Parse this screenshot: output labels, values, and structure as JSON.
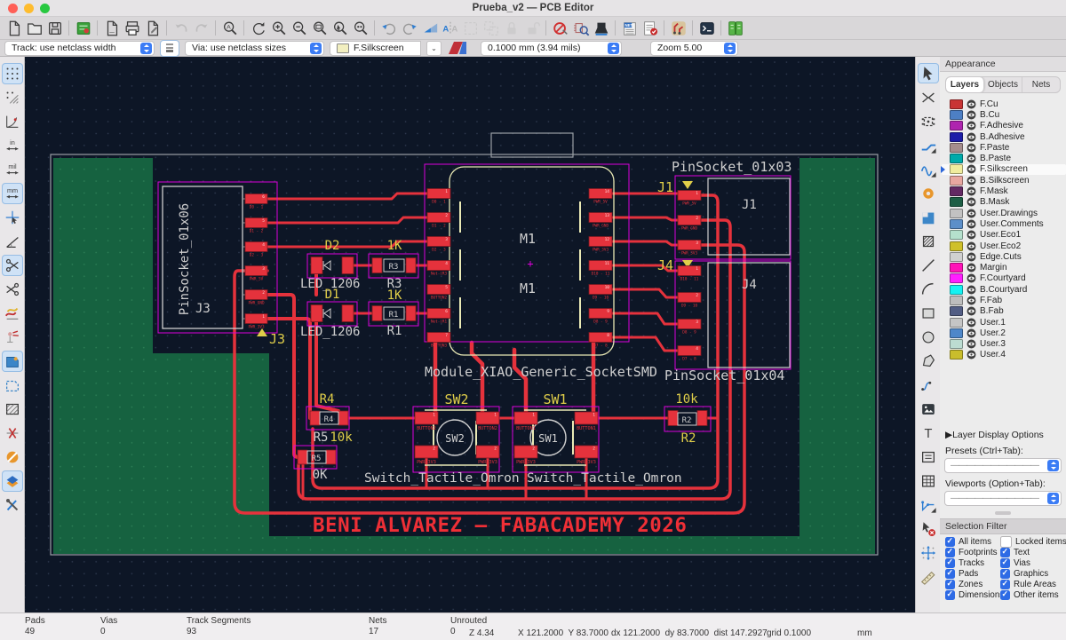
{
  "window": {
    "title": "Prueba_v2 — PCB Editor"
  },
  "toolbar_main": {
    "icons": [
      "new-board",
      "open-board",
      "save",
      "|",
      "board-setup",
      "|",
      "page-settings",
      "print",
      "plot",
      "|",
      "undo",
      "redo",
      "|",
      "find",
      "|",
      "refresh",
      "zoom-in",
      "zoom-out",
      "zoom-fit",
      "zoom-selection",
      "zoom-objects",
      "|",
      "rotate-ccw",
      "rotate-cw",
      "flip-board",
      "mirror",
      "group",
      "ungroup",
      "lock",
      "unlock",
      "|",
      "drc-exclusions",
      "footprint-checker",
      "plot-fab",
      "|",
      "net-inspector",
      "drc",
      "|",
      "router-settings",
      "|",
      "scripting-console",
      "|",
      "update-pcb"
    ],
    "disabled": [
      "undo",
      "redo",
      "group",
      "ungroup",
      "lock",
      "unlock"
    ]
  },
  "toolbar_options": {
    "track_combo": "Track: use netclass width",
    "via_combo": "Via: use netclass sizes",
    "layer_combo": "F.Silkscreen",
    "layer_swatch_color": "#f2efc0",
    "grid_combo": "0.1000 mm (3.94 mils)",
    "zoom_combo": "Zoom 5.00"
  },
  "left_toolbar": {
    "icons": [
      {
        "name": "grid-dots",
        "selected": true
      },
      {
        "name": "grid-override"
      },
      {
        "name": "polar-coords"
      },
      {
        "name": "units-inches",
        "label": "in"
      },
      {
        "name": "units-mils",
        "label": "mil"
      },
      {
        "name": "units-mm",
        "label": "mm",
        "selected": true
      },
      {
        "name": "cursor-shape"
      },
      {
        "name": "free-angle"
      },
      {
        "name": "trim-tracks",
        "selected": true
      },
      {
        "name": "delete-tracks"
      },
      {
        "name": "highlight-collisions"
      },
      {
        "name": "highlight-net"
      },
      {
        "name": "zone-fill-display",
        "selected": true
      },
      {
        "name": "zone-outline-display"
      },
      {
        "name": "zone-hatch-display"
      },
      {
        "name": "ratsnest-hide"
      },
      {
        "name": "ratsnest-curved"
      },
      {
        "name": "inspect-clearance",
        "selected": true
      },
      {
        "name": "preferences-tools"
      }
    ]
  },
  "right_toolbar": {
    "icons": [
      {
        "name": "select",
        "selected": true
      },
      {
        "name": "local-ratsnest"
      },
      {
        "name": "add-footprint"
      },
      {
        "name": "route-tracks"
      },
      {
        "name": "route-diff-pairs"
      },
      {
        "name": "add-via"
      },
      {
        "name": "add-zone"
      },
      {
        "name": "add-keepout"
      },
      {
        "name": "draw-line"
      },
      {
        "name": "draw-arc"
      },
      {
        "name": "draw-rectangle"
      },
      {
        "name": "draw-circle"
      },
      {
        "name": "draw-polygon"
      },
      {
        "name": "draw-bezier"
      },
      {
        "name": "add-image"
      },
      {
        "name": "add-text"
      },
      {
        "name": "add-textbox"
      },
      {
        "name": "add-table"
      },
      {
        "name": "add-dimension"
      },
      {
        "name": "delete-tool"
      },
      {
        "name": "grid-origin"
      },
      {
        "name": "measure"
      }
    ]
  },
  "appearance": {
    "title": "Appearance",
    "tabs": [
      "Layers",
      "Objects",
      "Nets"
    ],
    "active_tab": "Layers",
    "layers": [
      {
        "name": "F.Cu",
        "color": "#c83434"
      },
      {
        "name": "B.Cu",
        "color": "#4d7fc4"
      },
      {
        "name": "F.Adhesive",
        "color": "#af25af"
      },
      {
        "name": "B.Adhesive",
        "color": "#1c1ca8"
      },
      {
        "name": "F.Paste",
        "color": "#a58d8d"
      },
      {
        "name": "B.Paste",
        "color": "#00aaaa"
      },
      {
        "name": "F.Silkscreen",
        "color": "#f0ec9e",
        "selected": true
      },
      {
        "name": "B.Silkscreen",
        "color": "#e8a6a0"
      },
      {
        "name": "F.Mask",
        "color": "#632963"
      },
      {
        "name": "B.Mask",
        "color": "#1d5e45"
      },
      {
        "name": "User.Drawings",
        "color": "#c2c2c2"
      },
      {
        "name": "User.Comments",
        "color": "#5c8fc9"
      },
      {
        "name": "User.Eco1",
        "color": "#b5e0cd"
      },
      {
        "name": "User.Eco2",
        "color": "#cfc02a"
      },
      {
        "name": "Edge.Cuts",
        "color": "#d0d0d0"
      },
      {
        "name": "Margin",
        "color": "#ff13b8"
      },
      {
        "name": "F.Courtyard",
        "color": "#ff1fff"
      },
      {
        "name": "B.Courtyard",
        "color": "#15f2f2"
      },
      {
        "name": "F.Fab",
        "color": "#bdbdbd"
      },
      {
        "name": "B.Fab",
        "color": "#525d84"
      },
      {
        "name": "User.1",
        "color": "#c5c5c5"
      },
      {
        "name": "User.2",
        "color": "#4e87c9"
      },
      {
        "name": "User.3",
        "color": "#bcdcd2"
      },
      {
        "name": "User.4",
        "color": "#c9bd2c"
      }
    ],
    "layer_display_options": "Layer Display Options",
    "presets_label": "Presets (Ctrl+Tab):",
    "presets_value": "———————————",
    "viewports_label": "Viewports (Option+Tab):",
    "viewports_value": "———————————"
  },
  "selection_filter": {
    "title": "Selection Filter",
    "items": [
      {
        "label": "All items",
        "checked": true
      },
      {
        "label": "Locked items",
        "checked": false
      },
      {
        "label": "Footprints",
        "checked": true
      },
      {
        "label": "Text",
        "checked": true
      },
      {
        "label": "Tracks",
        "checked": true
      },
      {
        "label": "Vias",
        "checked": true
      },
      {
        "label": "Pads",
        "checked": true
      },
      {
        "label": "Graphics",
        "checked": true
      },
      {
        "label": "Zones",
        "checked": true
      },
      {
        "label": "Rule Areas",
        "checked": true
      },
      {
        "label": "Dimensions",
        "checked": true
      },
      {
        "label": "Other items",
        "checked": true
      }
    ]
  },
  "status_bar": {
    "pads_label": "Pads",
    "pads": "49",
    "vias_label": "Vias",
    "vias": "0",
    "segments_label": "Track Segments",
    "segments": "93",
    "nets_label": "Nets",
    "nets": "17",
    "unrouted_label": "Unrouted",
    "unrouted": "0",
    "zoom": "Z 4.34",
    "position": "X 121.2000  Y 83.7000",
    "delta": "dx 121.2000  dy 83.7000  dist 147.2927",
    "grid": "grid 0.1000",
    "units": "mm"
  },
  "canvas": {
    "colors": {
      "background": "#0d1626",
      "zone_green": "#166240",
      "track_red": "#e5323c",
      "pad_red": "#e5323c",
      "silk_yellow": "#e0ce49",
      "fab_gray": "#cfcfcf",
      "courtyard": "#dc00dc",
      "pale_silk": "#e9e9b5",
      "banner_red": "#ef2f36"
    },
    "banner": "BENI ALVAREZ — FABACADEMY 2026",
    "module": {
      "name": "Module_XIAO_Generic_SocketSMD",
      "ref": "M1",
      "value": "M1",
      "left_pads": [
        {
          "num": "1",
          "net": "D0 - 1"
        },
        {
          "num": "2",
          "net": "D1 - 2"
        },
        {
          "num": "3",
          "net": "D2 - 3"
        },
        {
          "num": "4",
          "net": "Net-(R3"
        },
        {
          "num": "5",
          "net": "BUTTON2"
        },
        {
          "num": "6",
          "net": "Net-(R1"
        },
        {
          "num": "7",
          "net": "BUTTON3"
        }
      ],
      "right_pads": [
        {
          "num": "14",
          "net": "PWR_5V"
        },
        {
          "num": "13",
          "net": "PWR_GND"
        },
        {
          "num": "12",
          "net": "PWR_3V3"
        },
        {
          "num": "11",
          "net": "D10 - 11"
        },
        {
          "num": "10",
          "net": "D9 - 10"
        },
        {
          "num": "9",
          "net": "D8 - 9"
        },
        {
          "num": "8",
          "net": "D7 - 8"
        }
      ]
    },
    "j3": {
      "name": "PinSocket_01x06",
      "fab_ref": "J3",
      "silk_ref": "J3",
      "pads": [
        {
          "num": "6",
          "net": "D0 - 1"
        },
        {
          "num": "5",
          "net": "D1 - 2"
        },
        {
          "num": "4",
          "net": "D2 - 3"
        },
        {
          "num": "3",
          "net": "PWR_5V"
        },
        {
          "num": "2",
          "net": "PWR_GND"
        },
        {
          "num": "1",
          "net": "PWR_3V3"
        }
      ]
    },
    "j1": {
      "name": "PinSocket_01x03",
      "fab_ref": "J1",
      "silk_ref": "J1",
      "pads": [
        {
          "num": "1",
          "net": "PWR_5V"
        },
        {
          "num": "2",
          "net": "PWR_GND"
        },
        {
          "num": "3",
          "net": "PWR_3V3"
        }
      ]
    },
    "j4": {
      "name": "PinSocket_01x04",
      "fab_ref": "J4",
      "silk_ref": "J4",
      "pads": [
        {
          "num": "1",
          "net": "D10 - 11"
        },
        {
          "num": "2",
          "net": "D9 - 10"
        },
        {
          "num": "3",
          "net": "D8 - 9"
        },
        {
          "num": "4",
          "net": "D7 - 8"
        }
      ]
    },
    "d2": {
      "ref": "D2",
      "name": "LED_1206"
    },
    "d1": {
      "ref": "D1",
      "name": "LED_1206"
    },
    "r3": {
      "value": "1K",
      "fab_ref": "R3",
      "inner": "R3"
    },
    "r1": {
      "value": "1K",
      "fab_ref": "R1",
      "inner": "R1"
    },
    "r4": {
      "ref": "R4",
      "inner": "R4"
    },
    "r5": {
      "fab_ref": "R5",
      "value": "10k",
      "inner": "R5",
      "value2": "0K"
    },
    "r2": {
      "value": "10k",
      "ref": "R2",
      "inner": "R2"
    },
    "sw2": {
      "ref": "SW2",
      "inner": "SW2",
      "name": "Switch_Tactile_Omron",
      "pads": [
        {
          "num": "1",
          "net": "BUTTON2"
        },
        {
          "num": "1",
          "net": "BUTTON2"
        },
        {
          "num": "2",
          "net": "PWR_3V3"
        },
        {
          "num": "2",
          "net": "PWR_3V3"
        }
      ]
    },
    "sw1": {
      "ref": "SW1",
      "inner": "SW1",
      "name": "Switch_Tactile_Omron",
      "pads": [
        {
          "num": "1",
          "net": "BUTTON1"
        },
        {
          "num": "1",
          "net": "BUTTON1"
        },
        {
          "num": "2",
          "net": "PWR_3V3"
        },
        {
          "num": "2",
          "net": "PWR_3V3"
        }
      ]
    }
  }
}
